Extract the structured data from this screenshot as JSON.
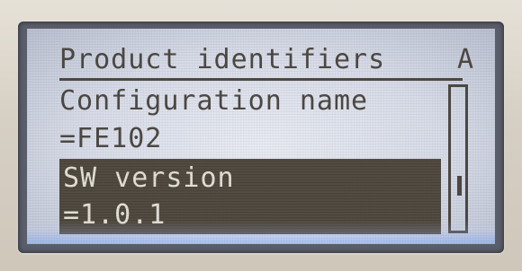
{
  "screen": {
    "title": "Product identifiers",
    "page_indicator": "A"
  },
  "items": [
    {
      "label": "Configuration name",
      "value": "=FE102",
      "selected": false
    },
    {
      "label": "SW version",
      "value": "=1.0.1",
      "selected": true
    }
  ],
  "scrollbar": {
    "position": 0.72,
    "thumb_fraction": 0.14
  },
  "colors": {
    "lcd_background": "#dfe3ed",
    "lcd_text": "#4b4640",
    "selection_background": "#514a3f",
    "selection_text": "#e4e0d8",
    "backlight": "#9fb9ff"
  }
}
